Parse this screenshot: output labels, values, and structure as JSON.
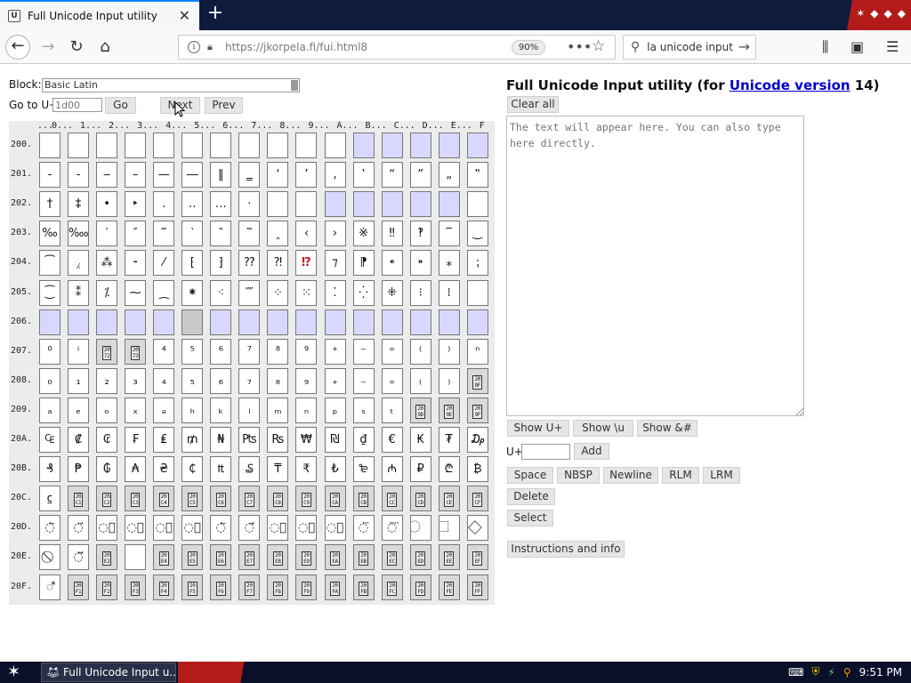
{
  "browser": {
    "tab_title": "Full Unicode Input utility",
    "url": "https://jkorpela.fi/fui.html8",
    "zoom": "90%",
    "search_text": "la unicode input"
  },
  "controls": {
    "block_label": "Block:",
    "block_value": "Basic Latin",
    "goto_label": "Go to U+",
    "goto_placeholder": "1d00",
    "go_button": "Go",
    "next_button": "Next",
    "prev_button": "Prev"
  },
  "grid": {
    "col_header": "...0...1...2...3...4...5...6...7...8...9...A...B...C...D...E...F",
    "columns": [
      "0",
      "1",
      "2",
      "3",
      "4",
      "5",
      "6",
      "7",
      "8",
      "9",
      "A",
      "B",
      "C",
      "D",
      "E",
      "F"
    ],
    "rows": [
      {
        "label": "200.",
        "cells": [
          " ",
          " ",
          " ",
          " ",
          " ",
          " ",
          " ",
          " ",
          " ",
          " ",
          " ",
          "#blue",
          "#blue",
          "#blue",
          "#blue",
          "#blue"
        ]
      },
      {
        "label": "201.",
        "cells": [
          "‐",
          "‑",
          "‒",
          "–",
          "—",
          "―",
          "‖",
          "‗",
          "‘",
          "’",
          "‚",
          "‛",
          "“",
          "”",
          "„",
          "‟"
        ]
      },
      {
        "label": "202.",
        "cells": [
          "†",
          "‡",
          "•",
          "‣",
          "․",
          "‥",
          "…",
          "‧",
          "#blank",
          "#blank",
          "#blue",
          "#blue",
          "#blue",
          "#blue",
          "#blue",
          " "
        ]
      },
      {
        "label": "203.",
        "cells": [
          "‰",
          "‱",
          "′",
          "″",
          "‴",
          "‵",
          "‶",
          "‷",
          "‸",
          "‹",
          "›",
          "※",
          "‼",
          "‽",
          "‾",
          "‿"
        ]
      },
      {
        "label": "204.",
        "cells": [
          "⁀",
          "⁁",
          "⁂",
          "⁃",
          "⁄",
          "⁅",
          "⁆",
          "⁇",
          "⁈",
          "⁉",
          "⁊",
          "⁋",
          "⁌",
          "⁍",
          "⁎",
          "⁏"
        ]
      },
      {
        "label": "205.",
        "cells": [
          "⁐",
          "⁑",
          "⁒",
          "⁓",
          "⁔",
          "⁕",
          "⁖",
          "⁗",
          "⁘",
          "⁙",
          "⁚",
          "⁛",
          "⁜",
          "⁝",
          "⁞",
          " "
        ]
      },
      {
        "label": "206.",
        "cells": [
          "#blue",
          "#blue",
          "#blue",
          "#blue",
          "#blue",
          "#grey",
          "#blue",
          "#blue",
          "#blue",
          "#blue",
          "#blue",
          "#blue",
          "#blue",
          "#blue",
          "#blue",
          "#blue"
        ]
      },
      {
        "label": "207.",
        "cells": [
          "⁰",
          "ⁱ",
          "#hex:2072",
          "#hex:2073",
          "⁴",
          "⁵",
          "⁶",
          "⁷",
          "⁸",
          "⁹",
          "⁺",
          "⁻",
          "⁼",
          "⁽",
          "⁾",
          "ⁿ"
        ]
      },
      {
        "label": "208.",
        "cells": [
          "₀",
          "₁",
          "₂",
          "₃",
          "₄",
          "₅",
          "₆",
          "₇",
          "₈",
          "₉",
          "₊",
          "₋",
          "₌",
          "₍",
          "₎",
          "#hex:208F"
        ]
      },
      {
        "label": "209.",
        "cells": [
          "ₐ",
          "ₑ",
          "ₒ",
          "ₓ",
          "ₔ",
          "ₕ",
          "ₖ",
          "ₗ",
          "ₘ",
          "ₙ",
          "ₚ",
          "ₛ",
          "ₜ",
          "#hex:209D",
          "#hex:209E",
          "#hex:209F"
        ]
      },
      {
        "label": "20A.",
        "cells": [
          "₠",
          "₡",
          "₢",
          "₣",
          "₤",
          "₥",
          "₦",
          "₧",
          "₨",
          "₩",
          "₪",
          "₫",
          "€",
          "₭",
          "₮",
          "₯"
        ]
      },
      {
        "label": "20B.",
        "cells": [
          "₰",
          "₱",
          "₲",
          "₳",
          "₴",
          "₵",
          "₶",
          "₷",
          "₸",
          "₹",
          "₺",
          "₻",
          "₼",
          "₽",
          "₾",
          "₿"
        ]
      },
      {
        "label": "20C.",
        "cells": [
          "⃀",
          "#hex:20C1",
          "#hex:20C2",
          "#hex:20C3",
          "#hex:20C4",
          "#hex:20C5",
          "#hex:20C6",
          "#hex:20C7",
          "#hex:20C8",
          "#hex:20C9",
          "#hex:20CA",
          "#hex:20CB",
          "#hex:20CC",
          "#hex:20CD",
          "#hex:20CE",
          "#hex:20CF"
        ]
      },
      {
        "label": "20D.",
        "cells": [
          "◌⃐",
          "◌⃑",
          "◌⃒",
          "◌⃓",
          "◌⃔",
          "◌⃕",
          "◌⃖",
          "◌⃗",
          "◌⃘",
          "◌⃙",
          "◌⃚",
          "◌⃛",
          "◌⃜",
          "⃝",
          "⃞",
          "⃟"
        ]
      },
      {
        "label": "20E.",
        "cells": [
          "⃠",
          "◌⃡",
          "#hex:20E2",
          " ",
          "#hex:20E4",
          "#hex:20E5",
          "#hex:20E6",
          "#hex:20E7",
          "#hex:20E8",
          "#hex:20E9",
          "#hex:20EA",
          "#hex:20EB",
          "#hex:20EC",
          "#hex:20ED",
          "#hex:20EE",
          "#hex:20EF"
        ]
      },
      {
        "label": "20F.",
        "cells": [
          "◌⃰",
          "#hex:20F1",
          "#hex:20F2",
          "#hex:20F3",
          "#hex:20F4",
          "#hex:20F5",
          "#hex:20F6",
          "#hex:20F7",
          "#hex:20F8",
          "#hex:20F9",
          "#hex:20FA",
          "#hex:20FB",
          "#hex:20FC",
          "#hex:20FD",
          "#hex:20FE",
          "#hex:20FF"
        ]
      }
    ]
  },
  "right": {
    "title_prefix": "Full Unicode Input utility (for ",
    "title_link": "Unicode version",
    "title_suffix": " 14)",
    "clear_all": "Clear all",
    "textarea_placeholder": "The text will appear here. You can also type here directly.",
    "show_uplus": "Show U+",
    "show_u": "Show \\u",
    "show_amp": "Show &#",
    "uplus_label": "U+",
    "add": "Add",
    "space": "Space",
    "nbsp": "NBSP",
    "newline": "Newline",
    "rlm": "RLM",
    "lrm": "LRM",
    "delete": "Delete",
    "select": "Select",
    "instructions": "Instructions and info"
  },
  "taskbar": {
    "task_title": "Full Unicode Input u...",
    "clock": "9:51 PM"
  },
  "colors": {
    "unassigned_blue": "#d8d8ff",
    "control_grey": "#c9c9c9",
    "link_blue": "#0000cc"
  }
}
